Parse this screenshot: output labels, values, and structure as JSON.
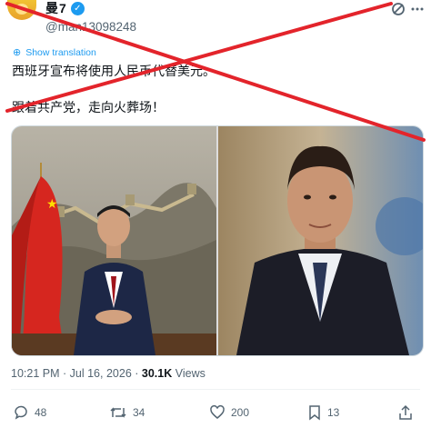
{
  "author": {
    "display_name": "曼7",
    "handle": "@man13098248",
    "verified": true
  },
  "header": {
    "icons": [
      "grok-icon",
      "more-icon"
    ]
  },
  "translate_label": "Show translation",
  "tweet": {
    "line1": "西班牙宣布将使用人民币代替美元。",
    "line2": "跟着共产党，走向火葬场！"
  },
  "meta": {
    "time": "10:21 PM",
    "separator": "·",
    "date": "Jul 16, 2026",
    "separator2": "·",
    "views_count": "30.1K",
    "views_label": "Views"
  },
  "actions": {
    "replies": "48",
    "reposts": "34",
    "likes": "200",
    "bookmarks": "13"
  },
  "colors": {
    "accent": "#1d9bf0",
    "strike": "#e3242b",
    "muted": "#536471"
  }
}
